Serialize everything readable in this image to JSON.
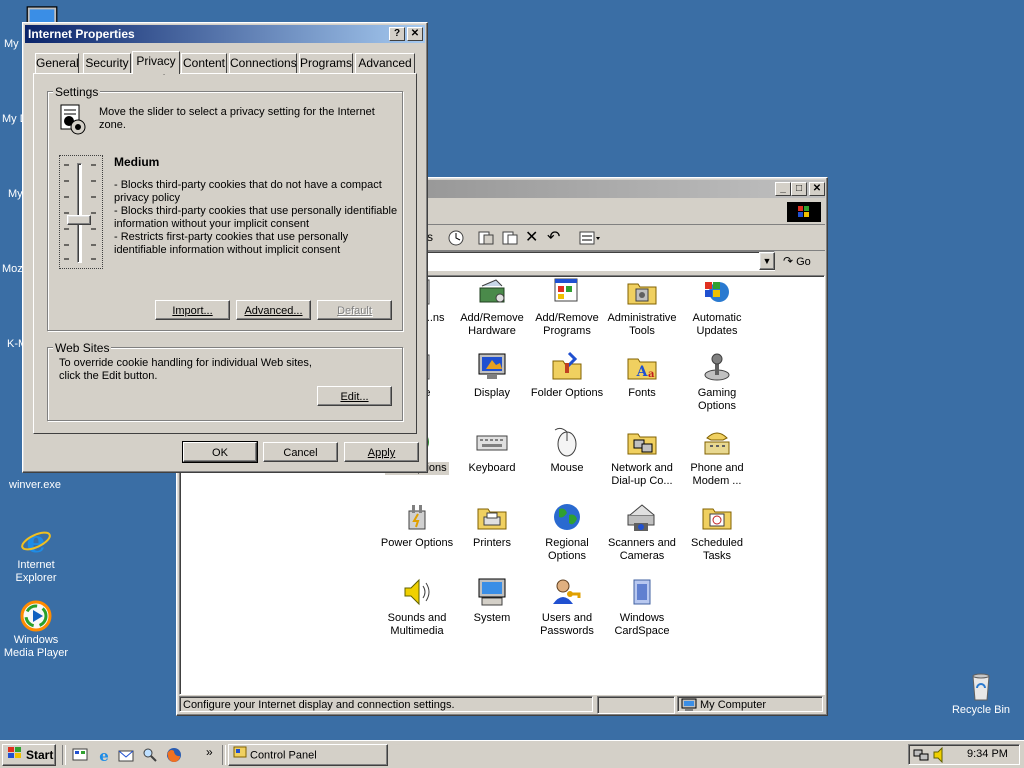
{
  "desktop": {
    "icons": [
      {
        "label": "My"
      },
      {
        "label": "My D"
      },
      {
        "label": "My"
      },
      {
        "label": "Moz"
      },
      {
        "label": "K-M"
      },
      {
        "label": "winver.exe"
      },
      {
        "label": "Internet Explorer"
      },
      {
        "label": "Windows Media Player"
      },
      {
        "label": "Recycle Bin"
      }
    ]
  },
  "dialog": {
    "title": "Internet Properties",
    "tabs": [
      "General",
      "Security",
      "Privacy",
      "Content",
      "Connections",
      "Programs",
      "Advanced"
    ],
    "selected_tab": "Privacy",
    "settings": {
      "group_label": "Settings",
      "intro": "Move the slider to select a privacy setting for the Internet zone.",
      "level_title": "Medium",
      "bullets": [
        "- Blocks third-party cookies that do not have a compact privacy policy",
        "- Blocks third-party cookies that use personally identifiable information without your implicit consent",
        "- Restricts first-party cookies that use personally identifiable information without implicit consent"
      ],
      "import_label": "Import...",
      "advanced_label": "Advanced...",
      "default_label": "Default"
    },
    "websites": {
      "group_label": "Web Sites",
      "text": "To override cookie handling for individual Web sites, click the Edit button.",
      "edit_label": "Edit..."
    },
    "ok_label": "OK",
    "cancel_label": "Cancel",
    "apply_label": "Apply"
  },
  "control_panel": {
    "address_go": "Go",
    "icons": [
      {
        "label": "...bility ...ns"
      },
      {
        "label": "Add/Remove Hardware"
      },
      {
        "label": "Add/Remove Programs"
      },
      {
        "label": "Administrative Tools"
      },
      {
        "label": "Automatic Updates"
      },
      {
        "label": "...ime"
      },
      {
        "label": "Display"
      },
      {
        "label": "Folder Options"
      },
      {
        "label": "Fonts"
      },
      {
        "label": "Gaming Options"
      },
      {
        "label": "...et Options"
      },
      {
        "label": "Keyboard"
      },
      {
        "label": "Mouse"
      },
      {
        "label": "Network and Dial-up Co..."
      },
      {
        "label": "Phone and Modem ..."
      },
      {
        "label": "Power Options"
      },
      {
        "label": "Printers"
      },
      {
        "label": "Regional Options"
      },
      {
        "label": "Scanners and Cameras"
      },
      {
        "label": "Scheduled Tasks"
      },
      {
        "label": "Sounds and Multimedia"
      },
      {
        "label": "System"
      },
      {
        "label": "Users and Passwords"
      },
      {
        "label": "Windows CardSpace"
      }
    ],
    "status_text": "Configure your Internet display and connection settings.",
    "status_zone": "My Computer"
  },
  "taskbar": {
    "start_label": "Start",
    "task_label": "Control Panel",
    "clock": "9:34 PM",
    "quicklaunch_more": "»"
  },
  "colors": {
    "desktop": "#3a6ea5",
    "titlebar_active": "#0a246a",
    "face": "#d4d0c8"
  }
}
